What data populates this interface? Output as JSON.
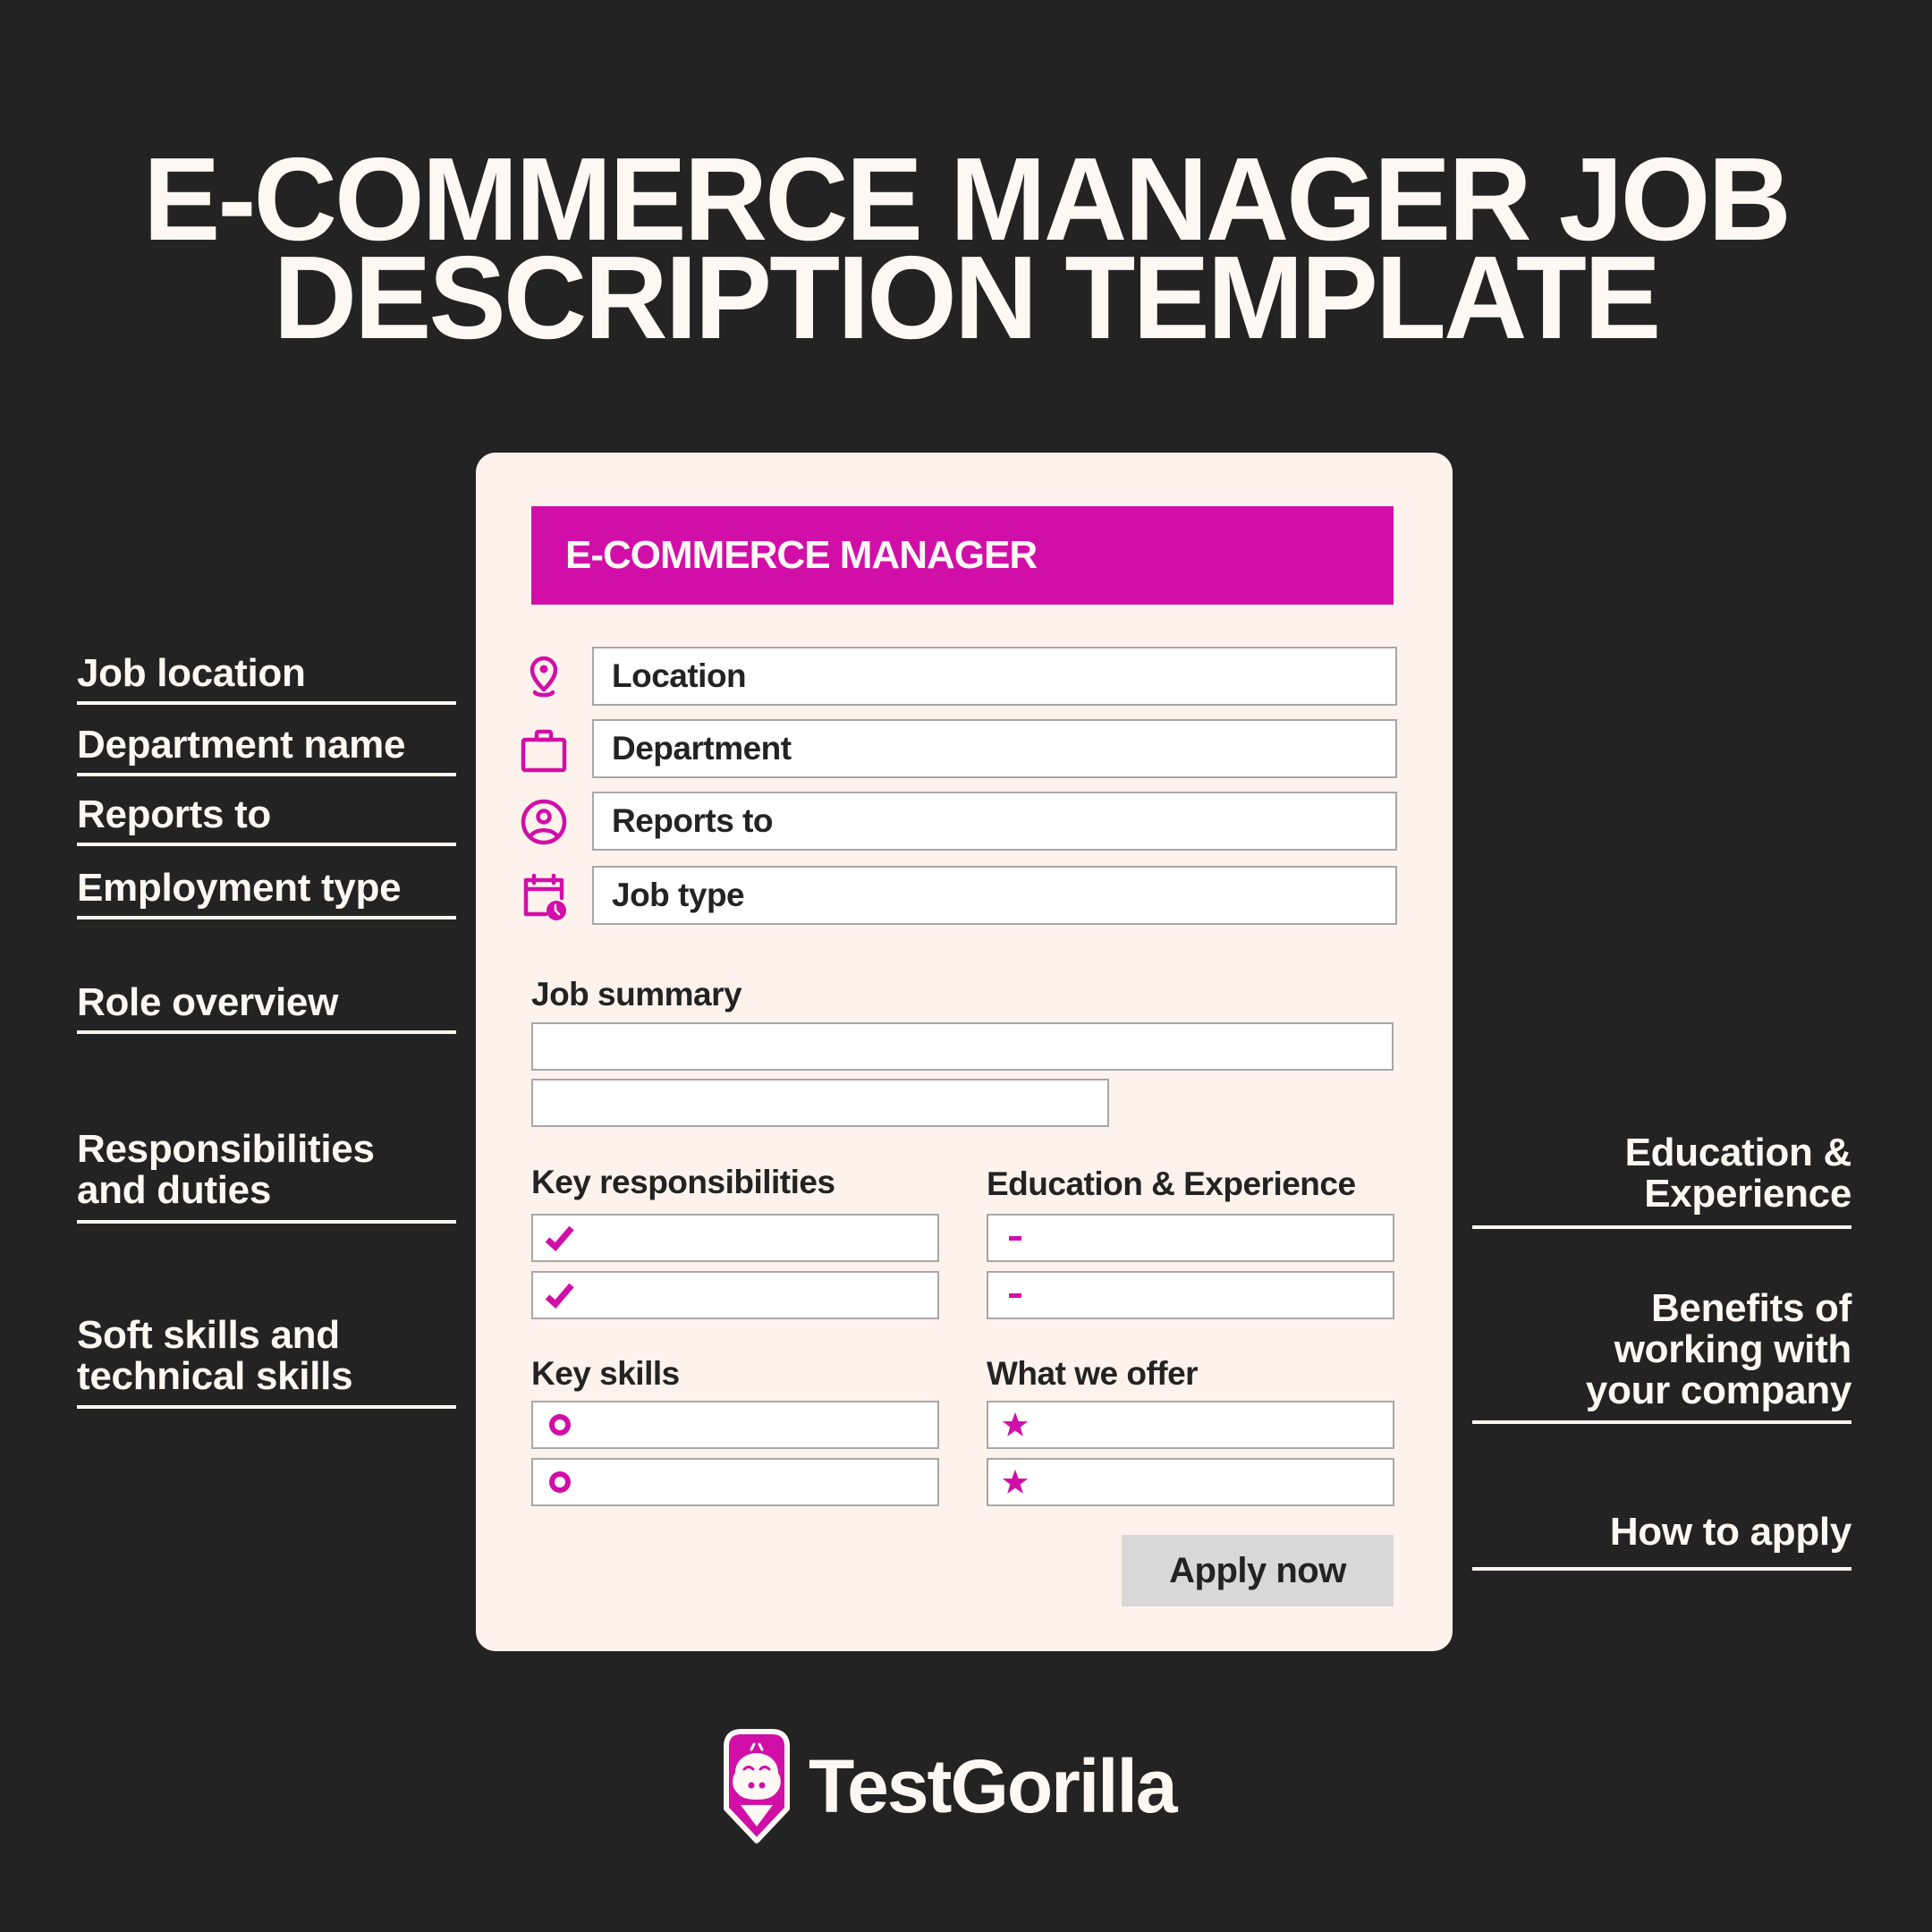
{
  "title": {
    "line1": "E-COMMERCE MANAGER JOB",
    "line2": "DESCRIPTION TEMPLATE"
  },
  "colors": {
    "background": "#232323",
    "card": "#fdf3ec",
    "accent": "#d10fa8",
    "field_border": "#a7a7a7",
    "button": "#d8d8d8",
    "text_light": "#fdf8f3",
    "text_dark": "#232323"
  },
  "left_labels": [
    {
      "lines": [
        "Job location"
      ]
    },
    {
      "lines": [
        "Department name"
      ]
    },
    {
      "lines": [
        "Reports to"
      ]
    },
    {
      "lines": [
        "Employment type"
      ]
    },
    {
      "lines": [
        "Role overview"
      ]
    },
    {
      "lines": [
        "Responsibilities",
        "and duties"
      ]
    },
    {
      "lines": [
        "Soft skills and",
        "technical skills"
      ]
    }
  ],
  "right_labels": [
    {
      "lines": [
        "Education &",
        "Experience"
      ]
    },
    {
      "lines": [
        "Benefits of",
        "working with",
        "your company"
      ]
    },
    {
      "lines": [
        "How to apply"
      ]
    }
  ],
  "card": {
    "banner_title": "E-COMMERCE MANAGER",
    "fields": [
      {
        "icon": "location-pin-icon",
        "value": "Location"
      },
      {
        "icon": "briefcase-icon",
        "value": "Department"
      },
      {
        "icon": "user-circle-icon",
        "value": "Reports to"
      },
      {
        "icon": "calendar-clock-icon",
        "value": "Job type"
      }
    ],
    "job_summary": {
      "label": "Job summary"
    },
    "key_responsibilities": {
      "label": "Key responsibilities",
      "bullet": "checkmark-icon",
      "items": 2
    },
    "education_experience": {
      "label": "Education & Experience",
      "bullet": "dash-icon",
      "items": 2
    },
    "key_skills": {
      "label": "Key skills",
      "bullet": "ring-icon",
      "items": 2
    },
    "what_we_offer": {
      "label": "What we offer",
      "bullet": "star-icon",
      "items": 2
    },
    "apply_button": "Apply now"
  },
  "brand": {
    "name": "TestGorilla",
    "logo_icon": "gorilla-logo-icon"
  }
}
